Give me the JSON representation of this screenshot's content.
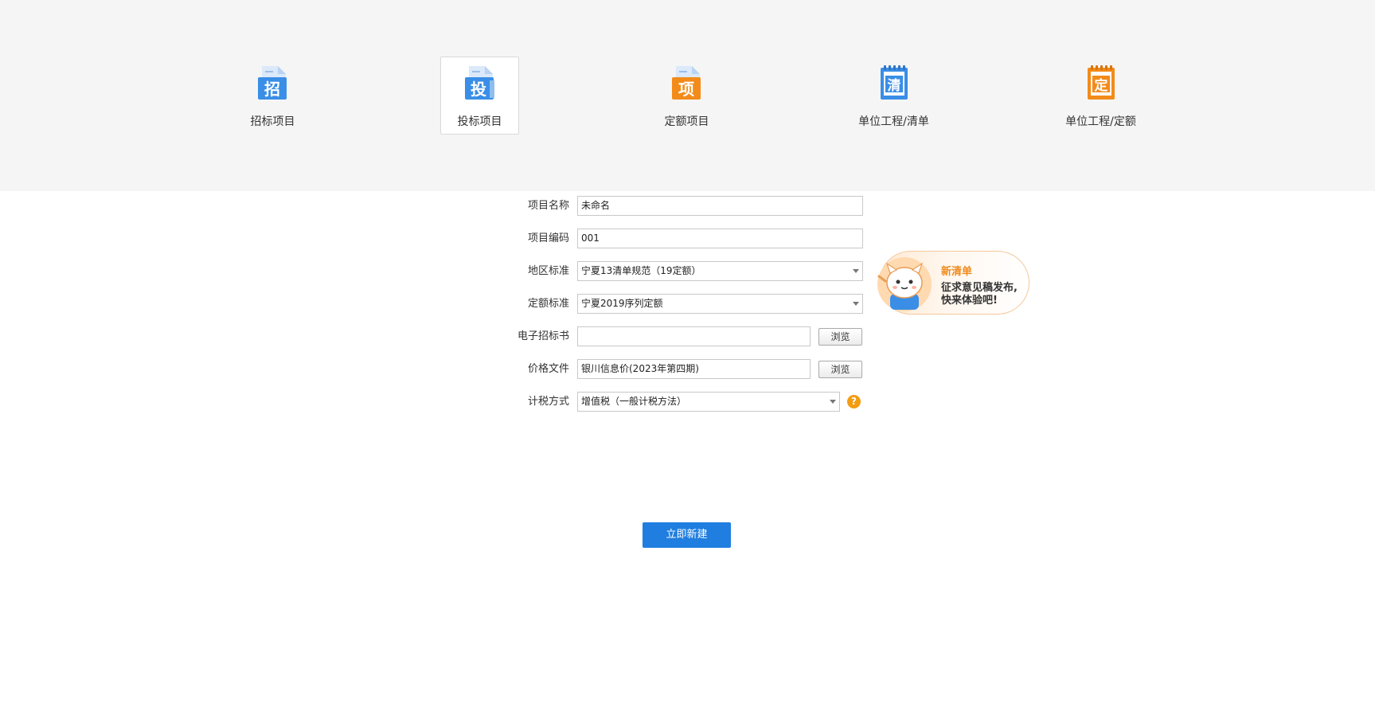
{
  "project_types": [
    {
      "label": "招标项目",
      "glyph": "招",
      "color": "#3a8ee6",
      "active": false
    },
    {
      "label": "投标项目",
      "glyph": "投",
      "color": "#3a8ee6",
      "active": true
    },
    {
      "label": "定额项目",
      "glyph": "项",
      "color": "#f28b1a",
      "active": false
    },
    {
      "label": "单位工程/清单",
      "glyph": "清",
      "color": "#3a8ee6",
      "active": false
    },
    {
      "label": "单位工程/定额",
      "glyph": "定",
      "color": "#f28b1a",
      "active": false
    }
  ],
  "form": {
    "project_name": {
      "label": "项目名称",
      "value": "未命名"
    },
    "project_code": {
      "label": "项目编码",
      "value": "001"
    },
    "region_standard": {
      "label": "地区标准",
      "value": "宁夏13清单规范（19定额）"
    },
    "quota_standard": {
      "label": "定额标准",
      "value": "宁夏2019序列定额"
    },
    "e_bid_file": {
      "label": "电子招标书",
      "value": "",
      "browse_label": "浏览"
    },
    "price_file": {
      "label": "价格文件",
      "value": "银川信息价(2023年第四期)",
      "browse_label": "浏览"
    },
    "tax_method": {
      "label": "计税方式",
      "value": "增值税（一般计税方法）",
      "help": "?"
    }
  },
  "promo": {
    "title": "新清单",
    "line1": "征求意见稿发布,",
    "line2": "快来体验吧!"
  },
  "create_button": {
    "label": "立即新建"
  },
  "colors": {
    "primary": "#1f7ee0",
    "blue_icon": "#3a8ee6",
    "orange_icon": "#f28b1a",
    "help": "#f39c12",
    "top_band": "#f5f5f5"
  }
}
